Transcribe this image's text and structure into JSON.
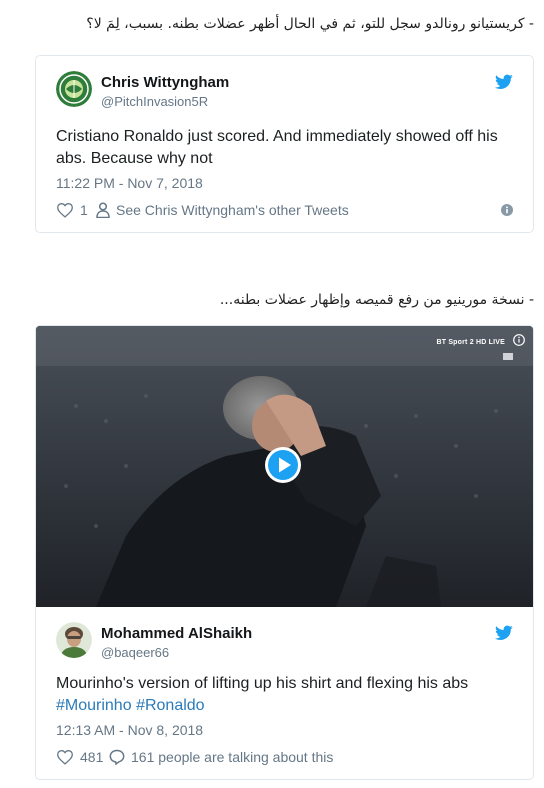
{
  "caption1": "- كريستيانو رونالدو سجل للتو، ثم في الحال أظهر عضلات بطنه. بسبب، لِمَ لا؟",
  "caption2": "- نسخة مورينيو من رفع قميصه وإظهار عضلات بطنه...",
  "tweet1": {
    "author_name": "Chris Wittyngham",
    "handle": "@PitchInvasion5R",
    "avatar_icon": "pitch-invasion-logo",
    "text": "Cristiano Ronaldo just scored. And immediately showed off his abs. Because why not",
    "timestamp": "11:22 PM - Nov 7, 2018",
    "likes": "1",
    "other_tweets_label": "See Chris Wittyngham's other Tweets"
  },
  "tweet2": {
    "video_brand": "BT Sport 2 HD LIVE",
    "author_name": "Mohammed AlShaikh",
    "handle": "@baqeer66",
    "avatar_icon": "man-avatar",
    "text": "Mourinho's version of lifting up his shirt and flexing his abs",
    "hashtag1": "#Mourinho",
    "hashtag2": "#Ronaldo",
    "timestamp": "12:13 AM - Nov 8, 2018",
    "likes": "481",
    "talking_label": "161 people are talking about this"
  },
  "colors": {
    "twitter_blue": "#1da1f2",
    "link_blue": "#2b7bb9",
    "meta_gray": "#657786",
    "border": "#e1e8ed"
  }
}
